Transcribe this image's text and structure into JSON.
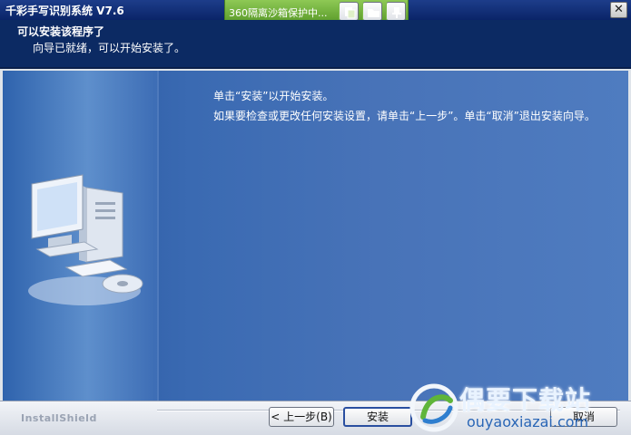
{
  "window": {
    "title": "千彩手写识别系统 V7.6",
    "close_glyph": "✕"
  },
  "sandbox_toolbar": {
    "label": "360隔离沙箱保护中...",
    "icons": [
      "sandbox-icon",
      "folder-icon",
      "pin-icon"
    ]
  },
  "header": {
    "title": "可以安装该程序了",
    "subtitle": "向导已就绪，可以开始安装了。"
  },
  "main": {
    "line1": "单击“安装”以开始安装。",
    "line2": "如果要检查或更改任何安装设置，请单击“上一步”。单击“取消”退出安装向导。"
  },
  "footer": {
    "brand": "InstallShield",
    "back_label": "< 上一步(B)",
    "install_label": "安装",
    "cancel_label": "取消"
  },
  "watermark": {
    "title": "偶要下载站",
    "url": "ouyaoxiazai.com"
  },
  "colors": {
    "title_bar": "#0a2468",
    "header": "#0c2a63",
    "content": "#3a6ab2",
    "sandbox": "#6aaa33"
  }
}
